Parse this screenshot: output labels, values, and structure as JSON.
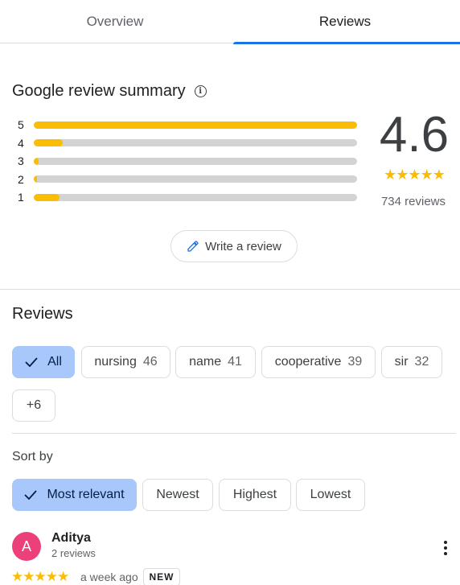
{
  "tabs": [
    {
      "label": "Overview",
      "active": false
    },
    {
      "label": "Reviews",
      "active": true
    }
  ],
  "summary": {
    "title": "Google review summary",
    "info_icon": "info-icon",
    "distribution": [
      {
        "label": "5",
        "fraction": 1.0
      },
      {
        "label": "4",
        "fraction": 0.09
      },
      {
        "label": "3",
        "fraction": 0.015
      },
      {
        "label": "2",
        "fraction": 0.01
      },
      {
        "label": "1",
        "fraction": 0.08
      }
    ],
    "rating": "4.6",
    "stars": "★★★★★",
    "star_value": 4.6,
    "review_count": "734 reviews",
    "write_review_label": "Write a review",
    "write_review_icon": "pencil-icon"
  },
  "reviews_section": {
    "heading": "Reviews",
    "filters": [
      {
        "label": "All",
        "count": "",
        "selected": true
      },
      {
        "label": "nursing",
        "count": "46",
        "selected": false
      },
      {
        "label": "name",
        "count": "41",
        "selected": false
      },
      {
        "label": "cooperative",
        "count": "39",
        "selected": false
      },
      {
        "label": "sir",
        "count": "32",
        "selected": false
      },
      {
        "label": "+6",
        "count": "",
        "selected": false
      }
    ],
    "sort_label": "Sort by",
    "sort_options": [
      {
        "label": "Most relevant",
        "selected": true
      },
      {
        "label": "Newest",
        "selected": false
      },
      {
        "label": "Highest",
        "selected": false
      },
      {
        "label": "Lowest",
        "selected": false
      }
    ]
  },
  "review": {
    "avatar_letter": "A",
    "name": "Aditya",
    "meta": "2 reviews",
    "stars": "★★★★★",
    "time": "a week ago",
    "badge": "NEW",
    "more_icon": "more-vert-icon"
  },
  "colors": {
    "accent": "#1a73e8",
    "star": "#fbbc04",
    "chip_selected": "#a8c7fa",
    "avatar": "#ec407a"
  }
}
